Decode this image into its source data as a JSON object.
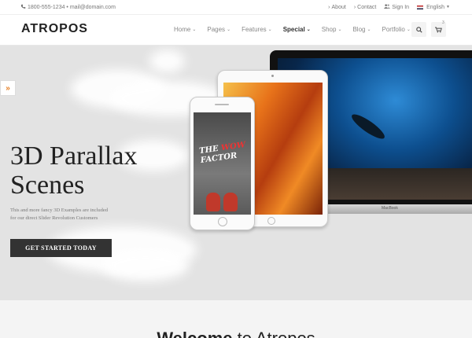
{
  "topbar": {
    "phone_icon": "phone-icon",
    "contact": "1800-555-1234 • mail@domain.com",
    "links": [
      {
        "label": "About",
        "icon": "chevron-right-icon"
      },
      {
        "label": "Contact",
        "icon": "chevron-right-icon"
      },
      {
        "label": "Sign In",
        "icon": "users-icon"
      }
    ],
    "language": "English"
  },
  "header": {
    "logo": "ATROPOS",
    "nav": [
      {
        "label": "Home",
        "active": false
      },
      {
        "label": "Pages",
        "active": false
      },
      {
        "label": "Features",
        "active": false
      },
      {
        "label": "Special",
        "active": true
      },
      {
        "label": "Shop",
        "active": false
      },
      {
        "label": "Blog",
        "active": false
      },
      {
        "label": "Portfolio",
        "active": false
      }
    ],
    "cart_count": "3"
  },
  "hero": {
    "side_tab": "»",
    "title_line1": "3D Parallax",
    "title_line2": "Scenes",
    "subtitle_line1": "This and more fancy 3D Examples are included",
    "subtitle_line2": "for our direct Slider Revolution Customers",
    "cta": "GET STARTED TODAY",
    "phone_text_line1": "THE ",
    "phone_text_wow": "WOW",
    "phone_text_line2": "FACTOR",
    "laptop_label": "MacBook"
  },
  "welcome": {
    "bold": "Welcome",
    "light": " to Atropos"
  }
}
